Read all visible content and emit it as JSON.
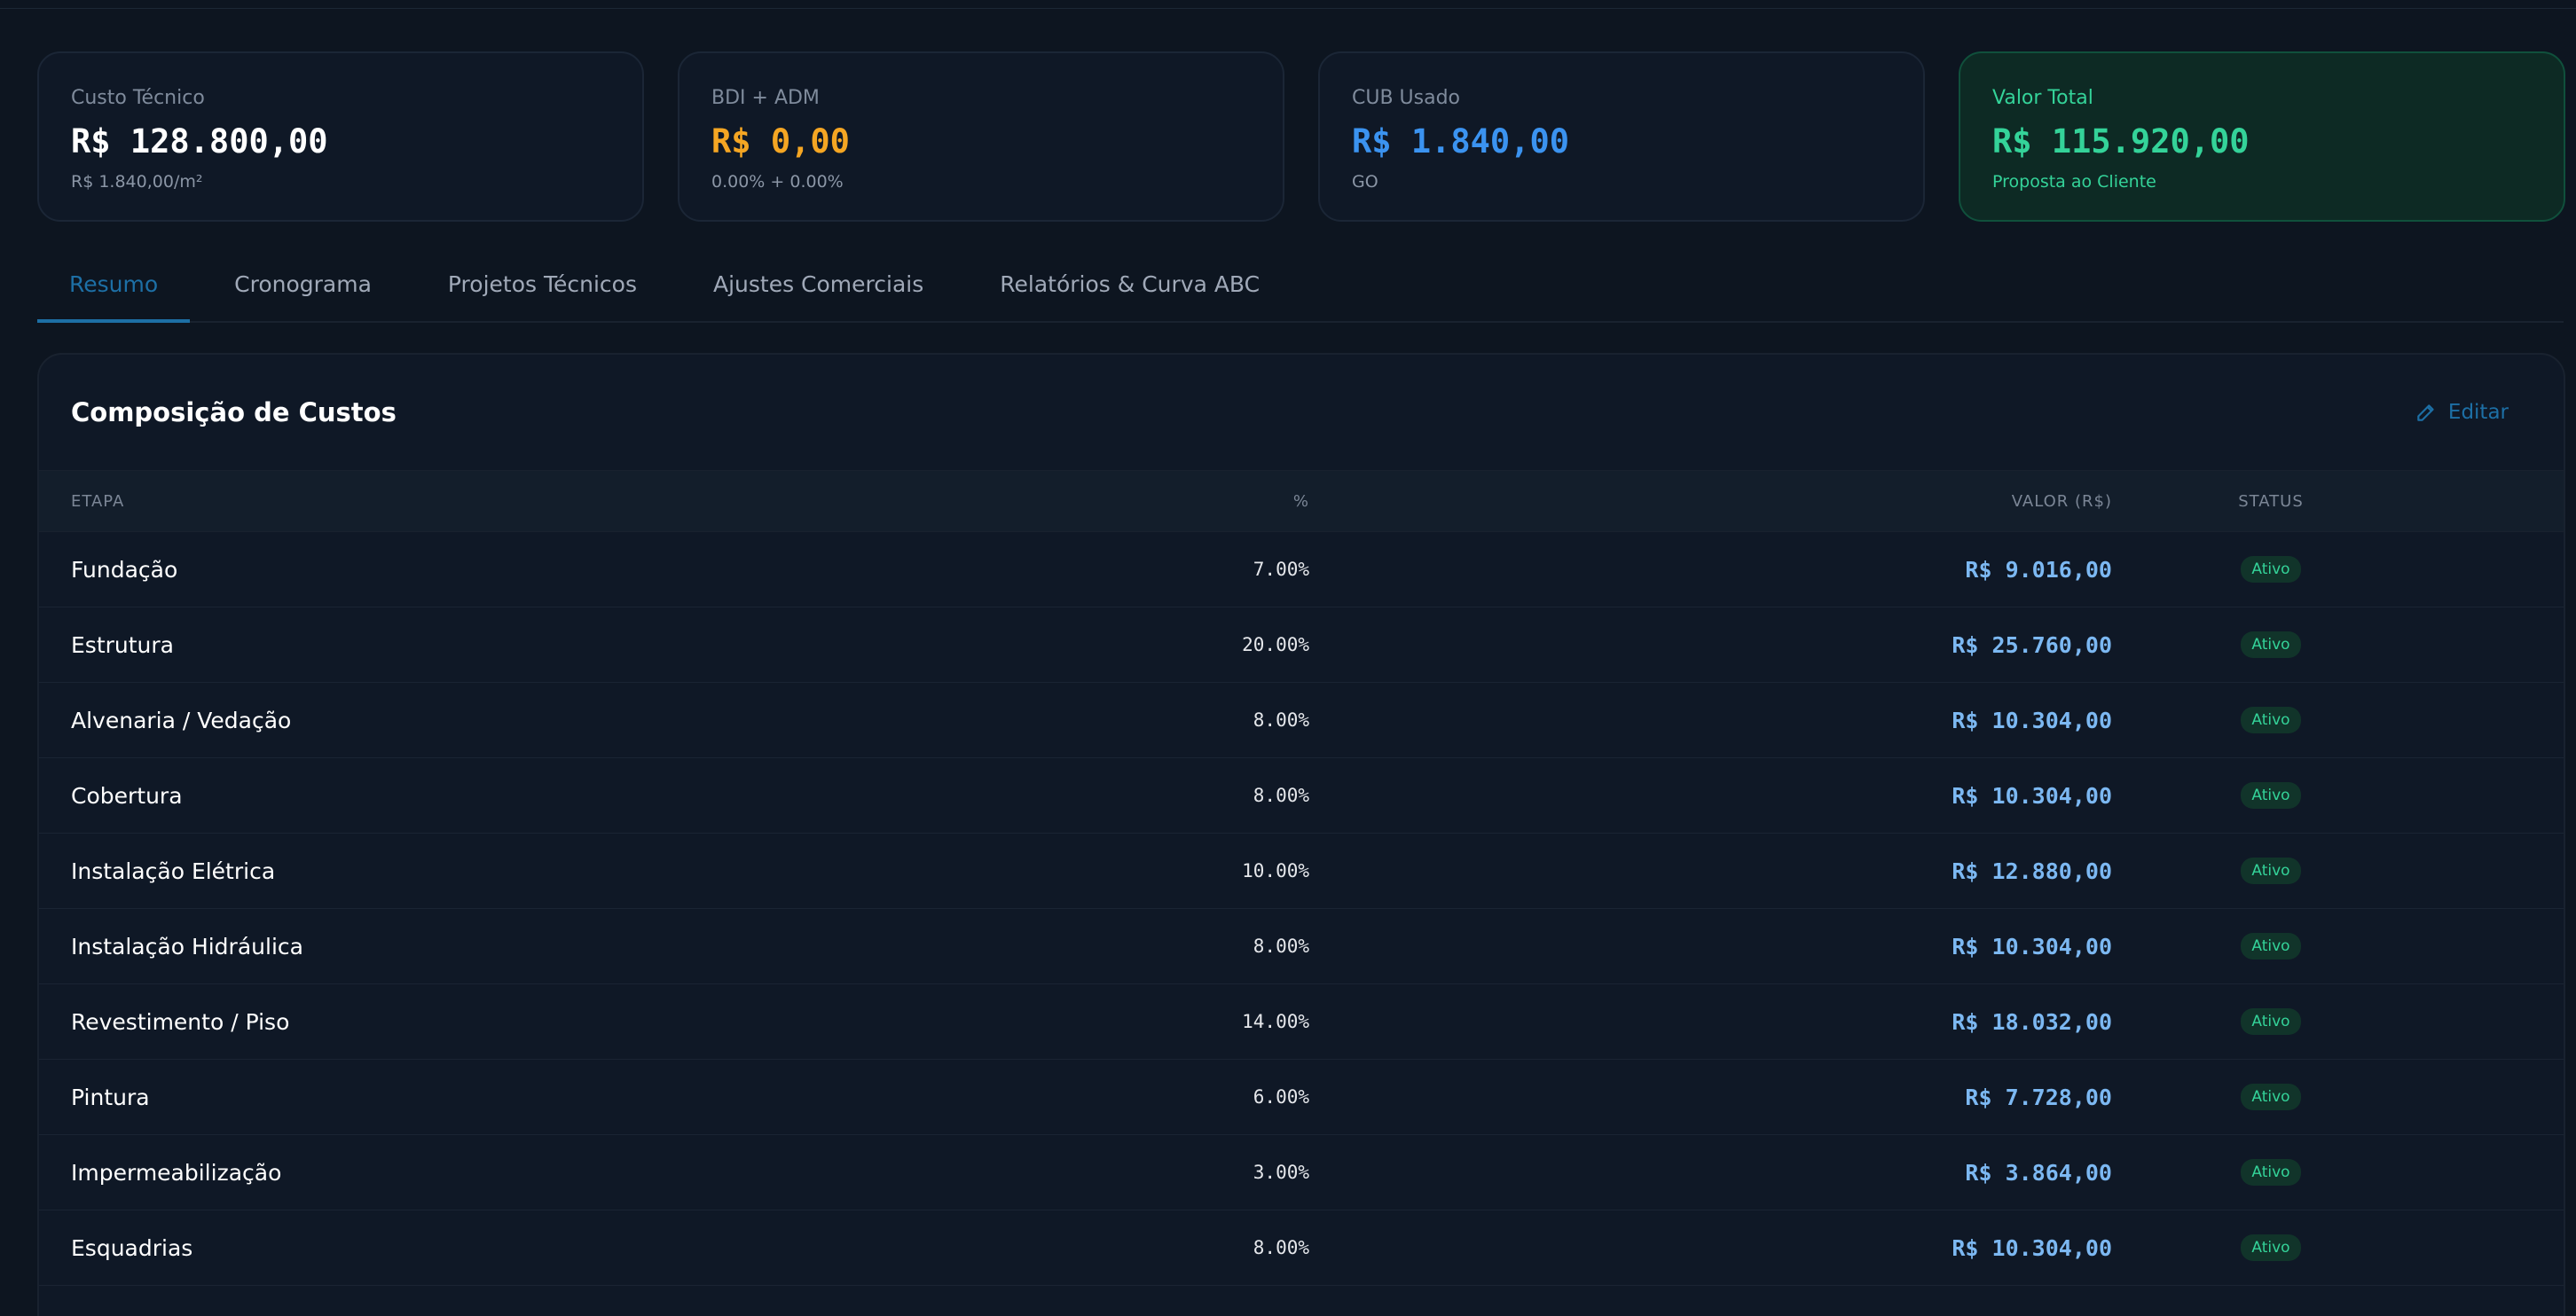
{
  "colors": {
    "background": "#0d1520",
    "accent": "#1d6fa5",
    "amber": "#f5a623",
    "blue": "#3b93f0",
    "green": "#34d399"
  },
  "cards": [
    {
      "label": "Custo Técnico",
      "value": "R$ 128.800,00",
      "sub": "R$ 1.840,00/m²"
    },
    {
      "label": "BDI + ADM",
      "value": "R$ 0,00",
      "sub": "0.00% + 0.00%"
    },
    {
      "label": "CUB Usado",
      "value": "R$ 1.840,00",
      "sub": "GO"
    },
    {
      "label": "Valor Total",
      "value": "R$ 115.920,00",
      "sub": "Proposta ao Cliente"
    }
  ],
  "tabs": [
    {
      "label": "Resumo",
      "active": true
    },
    {
      "label": "Cronograma"
    },
    {
      "label": "Projetos Técnicos"
    },
    {
      "label": "Ajustes Comerciais"
    },
    {
      "label": "Relatórios & Curva ABC"
    }
  ],
  "panel": {
    "title": "Composição de Custos",
    "edit_label": "Editar",
    "edit_icon": "pencil-icon",
    "columns": {
      "etapa": "ETAPA",
      "pct": "%",
      "valor": "VALOR (R$)",
      "status": "STATUS"
    },
    "rows": [
      {
        "etapa": "Fundação",
        "pct": "7.00%",
        "valor": "R$ 9.016,00",
        "status": "Ativo"
      },
      {
        "etapa": "Estrutura",
        "pct": "20.00%",
        "valor": "R$ 25.760,00",
        "status": "Ativo"
      },
      {
        "etapa": "Alvenaria / Vedação",
        "pct": "8.00%",
        "valor": "R$ 10.304,00",
        "status": "Ativo"
      },
      {
        "etapa": "Cobertura",
        "pct": "8.00%",
        "valor": "R$ 10.304,00",
        "status": "Ativo"
      },
      {
        "etapa": "Instalação Elétrica",
        "pct": "10.00%",
        "valor": "R$ 12.880,00",
        "status": "Ativo"
      },
      {
        "etapa": "Instalação Hidráulica",
        "pct": "8.00%",
        "valor": "R$ 10.304,00",
        "status": "Ativo"
      },
      {
        "etapa": "Revestimento / Piso",
        "pct": "14.00%",
        "valor": "R$ 18.032,00",
        "status": "Ativo"
      },
      {
        "etapa": "Pintura",
        "pct": "6.00%",
        "valor": "R$ 7.728,00",
        "status": "Ativo"
      },
      {
        "etapa": "Impermeabilização",
        "pct": "3.00%",
        "valor": "R$ 3.864,00",
        "status": "Ativo"
      },
      {
        "etapa": "Esquadrias",
        "pct": "8.00%",
        "valor": "R$ 10.304,00",
        "status": "Ativo"
      }
    ]
  }
}
